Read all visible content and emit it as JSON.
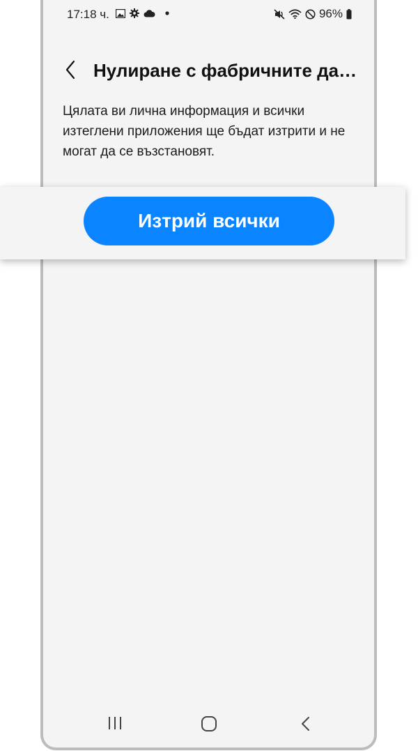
{
  "status_bar": {
    "time": "17:18 ч.",
    "left_icons": [
      "gallery-icon",
      "gear-icon",
      "cloud-icon",
      "dot-icon"
    ],
    "right_icons": [
      "mute-vibrate-icon",
      "wifi-icon",
      "do-not-disturb-icon"
    ],
    "battery_percent": "96%"
  },
  "header": {
    "back_icon": "chevron-left-icon",
    "title": "Нулиране с фабричните да…"
  },
  "description": "Цялата ви лична информация и всички изтеглени приложения ще бъдат изтрити и не могат да се възстановят.",
  "actions": {
    "delete_all_label": "Изтрий всички"
  },
  "navigation_bar": {
    "recents_icon": "recents-icon",
    "home_icon": "home-icon",
    "back_icon": "back-icon"
  },
  "colors": {
    "accent": "#0a84ff",
    "screen_background": "#f4f4f4",
    "frame": "#bcbcbc"
  }
}
